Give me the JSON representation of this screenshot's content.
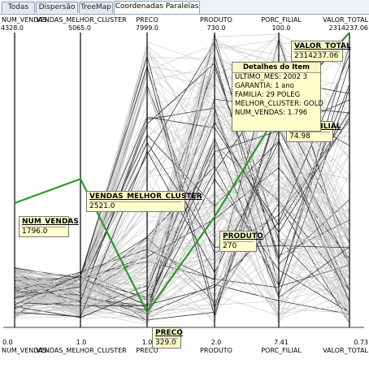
{
  "tabs": [
    {
      "label": "Todas",
      "active": false
    },
    {
      "label": "Dispersão",
      "active": false
    },
    {
      "label": "TreeMap",
      "active": false
    },
    {
      "label": "Coordenadas Paralelas",
      "active": true
    }
  ],
  "axes": [
    {
      "name": "NUM_VENDAS",
      "max": "4328.0",
      "min": "0.0"
    },
    {
      "name": "VENDAS_MELHOR_CLUSTER",
      "max": "5065.0",
      "min": "1.0"
    },
    {
      "name": "PRECO",
      "max": "7999.0",
      "min": "1.0"
    },
    {
      "name": "PRODUTO",
      "max": "730.0",
      "min": "2.0"
    },
    {
      "name": "PORC_FILIAL",
      "max": "100.0",
      "min": "7.41"
    },
    {
      "name": "VALOR_TOTAL",
      "max": "2314237.06",
      "min": "0.73"
    }
  ],
  "selected_record": {
    "NUM_VENDAS": "1796.0",
    "VENDAS_MELHOR_CLUSTER": "2521.0",
    "PRECO": "329.0",
    "PRODUTO": "270",
    "PORC_FILIAL": "74.98",
    "VALOR_TOTAL": "2314237.06"
  },
  "selected_fraction": [
    0.415,
    0.498,
    0.041,
    0.368,
    0.729,
    1.0
  ],
  "details": {
    "title": "Detalhes do Item",
    "lines": [
      "ULTIMO_MES: 2002        3",
      "GARANTIA: 1 ano",
      "FAMILIA: 29 POLEG",
      "MELHOR_CLUSTER: GOLD",
      "NUM_VENDAS: 1.796"
    ]
  },
  "colors": {
    "highlight": "#2a9a2a",
    "background_lines": "#c6c6c6",
    "dark_lines": "#333333",
    "tooltip_bg": "#ffffcc"
  }
}
